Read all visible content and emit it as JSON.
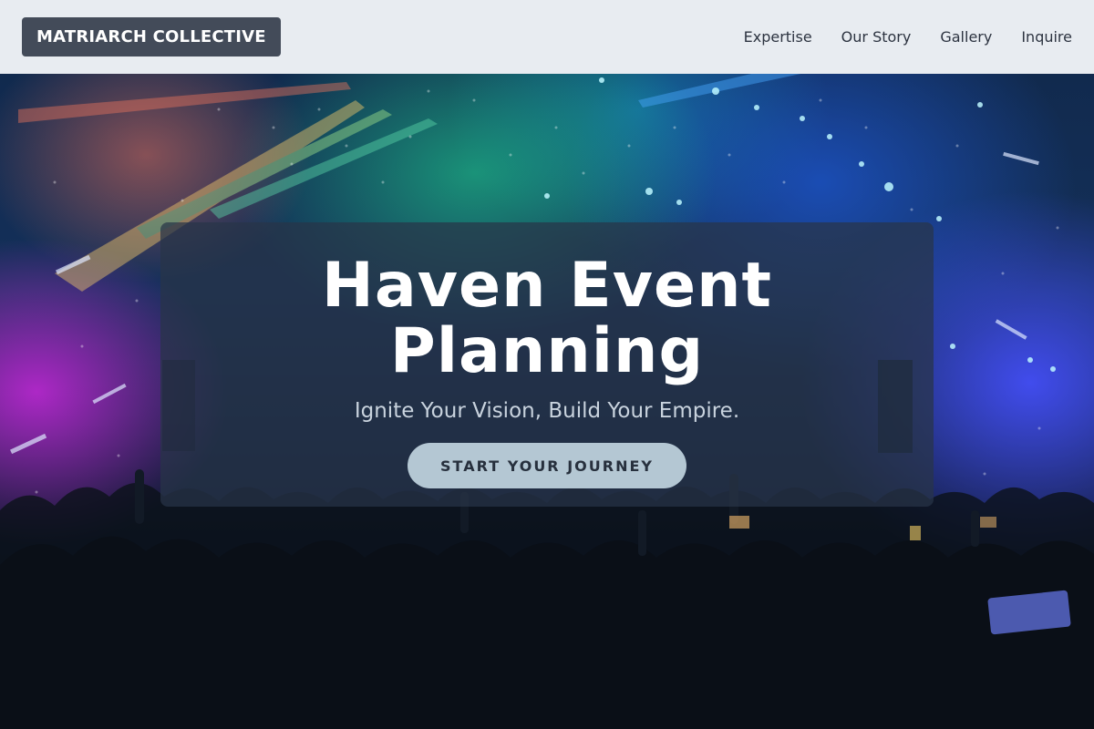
{
  "nav": {
    "brand": "MATRIARCH COLLECTIVE",
    "links": [
      "Expertise",
      "Our Story",
      "Gallery",
      "Inquire"
    ]
  },
  "hero": {
    "title": "Haven Event Planning",
    "subtitle": "Ignite Your Vision, Build Your Empire.",
    "cta_label": "START YOUR JOURNEY",
    "background_image": "concert-crowd-photo"
  },
  "colors": {
    "nav_background": "#e8ecf1",
    "brand_background": "#434b59",
    "card_overlay": "#283448",
    "cta_background": "#b4c7d3",
    "cta_text": "#27303d"
  }
}
